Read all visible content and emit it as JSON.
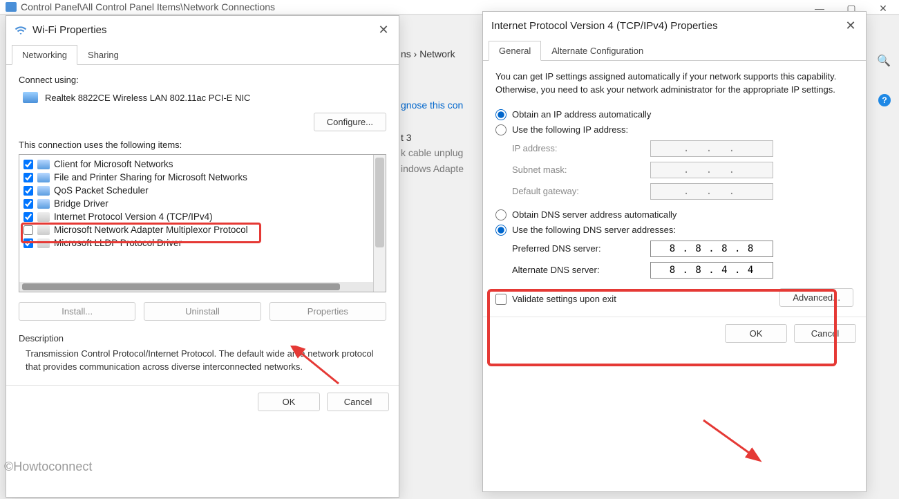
{
  "bg": {
    "title": "Control Panel\\All Control Panel Items\\Network Connections",
    "breadcrumb_segment1": "ns",
    "breadcrumb_segment2": "Network",
    "diagnose_link": "gnose this con",
    "eth_name": "t 3",
    "eth_line1": "k cable unplug",
    "eth_line2": "indows Adapte"
  },
  "wifi": {
    "title": "Wi-Fi Properties",
    "tabs": {
      "networking": "Networking",
      "sharing": "Sharing"
    },
    "connect_using": "Connect using:",
    "adapter": "Realtek 8822CE Wireless LAN 802.11ac PCI-E NIC",
    "configure": "Configure...",
    "items_label": "This connection uses the following items:",
    "items": [
      {
        "checked": true,
        "label": "Client for Microsoft Networks"
      },
      {
        "checked": true,
        "label": "File and Printer Sharing for Microsoft Networks"
      },
      {
        "checked": true,
        "label": "QoS Packet Scheduler"
      },
      {
        "checked": true,
        "label": "Bridge Driver"
      },
      {
        "checked": true,
        "label": "Internet Protocol Version 4 (TCP/IPv4)"
      },
      {
        "checked": false,
        "label": "Microsoft Network Adapter Multiplexor Protocol"
      },
      {
        "checked": true,
        "label": "Microsoft LLDP Protocol Driver"
      }
    ],
    "install": "Install...",
    "uninstall": "Uninstall",
    "properties": "Properties",
    "desc_legend": "Description",
    "desc_text": "Transmission Control Protocol/Internet Protocol. The default wide area network protocol that provides communication across diverse interconnected networks.",
    "ok": "OK",
    "cancel": "Cancel"
  },
  "ipv4": {
    "title": "Internet Protocol Version 4 (TCP/IPv4) Properties",
    "tabs": {
      "general": "General",
      "alt": "Alternate Configuration"
    },
    "info": "You can get IP settings assigned automatically if your network supports this capability. Otherwise, you need to ask your network administrator for the appropriate IP settings.",
    "obtain_ip": "Obtain an IP address automatically",
    "use_ip": "Use the following IP address:",
    "ip_address_label": "IP address:",
    "subnet_label": "Subnet mask:",
    "gateway_label": "Default gateway:",
    "obtain_dns": "Obtain DNS server address automatically",
    "use_dns": "Use the following DNS server addresses:",
    "preferred_dns_label": "Preferred DNS server:",
    "alternate_dns_label": "Alternate DNS server:",
    "preferred_dns_value": "8 . 8 . 8 . 8",
    "alternate_dns_value": "8 . 8 . 4 . 4",
    "validate": "Validate settings upon exit",
    "advanced": "Advanced...",
    "ok": "OK",
    "cancel": "Cancel"
  },
  "watermark": "©Howtoconnect"
}
